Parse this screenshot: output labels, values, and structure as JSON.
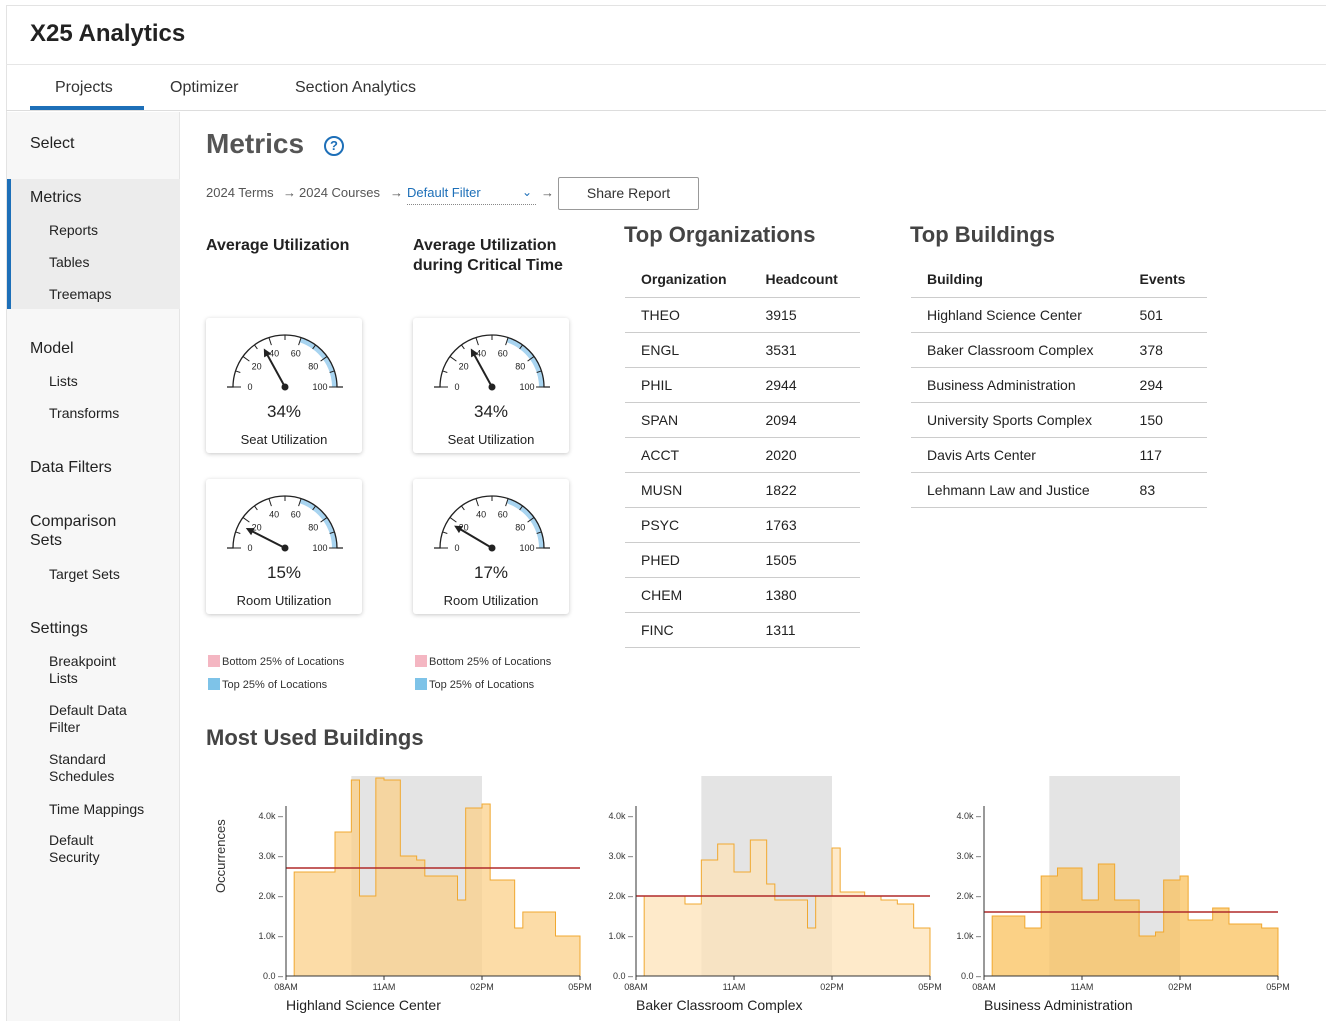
{
  "app": {
    "title": "X25 Analytics"
  },
  "tabs": [
    {
      "label": "Projects"
    },
    {
      "label": "Optimizer"
    },
    {
      "label": "Section Analytics"
    }
  ],
  "sidebar": {
    "select": "Select",
    "metrics": "Metrics",
    "metrics_items": [
      "Reports",
      "Tables",
      "Treemaps"
    ],
    "model": "Model",
    "model_items": [
      "Lists",
      "Transforms"
    ],
    "data_filters": "Data Filters",
    "comparison_sets": "Comparison Sets",
    "comparison_items": [
      "Target Sets"
    ],
    "settings": "Settings",
    "settings_items": [
      "Breakpoint Lists",
      "Default Data Filter",
      "Standard Schedules",
      "Time Mappings",
      "Default Security"
    ]
  },
  "page": {
    "title": "Metrics",
    "help_icon": "question-circle-icon",
    "breadcrumb": {
      "terms": "2024 Terms",
      "courses": "2024 Courses",
      "arrow": "→",
      "filter": "Default Filter",
      "filter_icon": "chevron-down-icon"
    },
    "share_button": "Share Report"
  },
  "utilization": {
    "avg_label": "Average Utilization",
    "critical_label": "Average Utilization during Critical Time",
    "gauges": [
      {
        "value": 34,
        "display": "34%",
        "caption": "Seat Utilization"
      },
      {
        "value": 34,
        "display": "34%",
        "caption": "Seat Utilization"
      },
      {
        "value": 15,
        "display": "15%",
        "caption": "Room Utilization"
      },
      {
        "value": 17,
        "display": "17%",
        "caption": "Room Utilization"
      }
    ],
    "gauge_ticks": [
      "0",
      "20",
      "40",
      "60",
      "80",
      "100"
    ],
    "legend": {
      "bottom": "Bottom 25% of Locations",
      "top": "Top 25% of Locations"
    },
    "colors": {
      "bottom": "#f4b6c2",
      "top": "#7ec3e8",
      "gauge_band": "#a8d4f0"
    }
  },
  "top_orgs": {
    "title": "Top Organizations",
    "headers": [
      "Organization",
      "Headcount"
    ],
    "rows": [
      [
        "THEO",
        "3915"
      ],
      [
        "ENGL",
        "3531"
      ],
      [
        "PHIL",
        "2944"
      ],
      [
        "SPAN",
        "2094"
      ],
      [
        "ACCT",
        "2020"
      ],
      [
        "MUSN",
        "1822"
      ],
      [
        "PSYC",
        "1763"
      ],
      [
        "PHED",
        "1505"
      ],
      [
        "CHEM",
        "1380"
      ],
      [
        "FINC",
        "1311"
      ]
    ]
  },
  "top_buildings": {
    "title": "Top Buildings",
    "headers": [
      "Building",
      "Events"
    ],
    "rows": [
      [
        "Highland Science Center",
        "501"
      ],
      [
        "Baker Classroom Complex",
        "378"
      ],
      [
        "Business Administration",
        "294"
      ],
      [
        "University Sports Complex",
        "150"
      ],
      [
        "Davis Arts Center",
        "117"
      ],
      [
        "Lehmann Law and Justice",
        "83"
      ]
    ]
  },
  "most_used": {
    "title": "Most Used Buildings",
    "ylabel": "Occurrences"
  },
  "chart_data": [
    {
      "type": "area",
      "title": "Highland Science Center",
      "ylabel": "Occurrences",
      "ylim": [
        0,
        5000
      ],
      "yticks": [
        "0.0",
        "1.0k",
        "2.0k",
        "3.0k",
        "4.0k"
      ],
      "xticks": [
        "08AM",
        "11AM",
        "02PM",
        "05PM"
      ],
      "highlight_range": [
        10,
        14
      ],
      "average": 2700,
      "fill": "#fbd08a",
      "stroke": "#f0a830",
      "x": [
        8,
        8.25,
        9.5,
        10,
        10.25,
        10.75,
        11,
        11.5,
        12,
        12.25,
        13.25,
        13.5,
        14,
        14.25,
        15,
        15.25,
        16.25,
        17
      ],
      "values": [
        0,
        2600,
        3600,
        4900,
        2000,
        4950,
        4900,
        3000,
        2900,
        2500,
        1900,
        4200,
        4300,
        2400,
        1200,
        1600,
        1000,
        500
      ]
    },
    {
      "type": "area",
      "title": "Baker Classroom Complex",
      "ylabel": "",
      "ylim": [
        0,
        5000
      ],
      "yticks": [
        "0.0",
        "1.0k",
        "2.0k",
        "3.0k",
        "4.0k"
      ],
      "xticks": [
        "08AM",
        "11AM",
        "02PM",
        "05PM"
      ],
      "highlight_range": [
        10,
        14
      ],
      "average": 2000,
      "fill": "#fde3b8",
      "stroke": "#f0a830",
      "x": [
        8,
        8.25,
        9.5,
        10,
        10.5,
        11,
        11.5,
        12,
        12.25,
        13.25,
        13.5,
        14,
        14.25,
        15,
        15.5,
        16,
        16.5,
        17
      ],
      "values": [
        0,
        2000,
        1800,
        2900,
        3300,
        2600,
        3400,
        2300,
        1900,
        1200,
        2000,
        3200,
        2100,
        2000,
        1900,
        1800,
        1200,
        900
      ]
    },
    {
      "type": "area",
      "title": "Business Administration",
      "ylabel": "",
      "ylim": [
        0,
        5000
      ],
      "yticks": [
        "0.0",
        "1.0k",
        "2.0k",
        "3.0k",
        "4.0k"
      ],
      "xticks": [
        "08AM",
        "11AM",
        "02PM",
        "05PM"
      ],
      "highlight_range": [
        10,
        14
      ],
      "average": 1600,
      "fill": "#f9c25e",
      "stroke": "#f0a830",
      "x": [
        8,
        8.25,
        9.25,
        9.75,
        10.25,
        11,
        11.5,
        12,
        12.75,
        13.25,
        13.5,
        14,
        14.25,
        15,
        15.5,
        16,
        16.5,
        17
      ],
      "values": [
        0,
        1500,
        1200,
        2500,
        2700,
        1900,
        2800,
        1900,
        1000,
        1100,
        2400,
        2500,
        1400,
        1700,
        1300,
        1300,
        1200,
        600
      ]
    }
  ]
}
